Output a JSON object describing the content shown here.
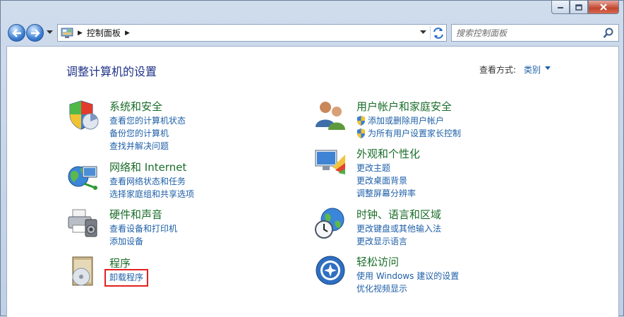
{
  "address": {
    "crumb": "控制面板",
    "search_placeholder": "搜索控制面板"
  },
  "header": {
    "title": "调整计算机的设置",
    "view_by_label": "查看方式:",
    "view_by_value": "类别"
  },
  "categories": [
    {
      "title": "系统和安全",
      "links": [
        "查看您的计算机状态",
        "备份您的计算机",
        "查找并解决问题"
      ]
    },
    {
      "title": "网络和 Internet",
      "links": [
        "查看网络状态和任务",
        "选择家庭组和共享选项"
      ]
    },
    {
      "title": "硬件和声音",
      "links": [
        "查看设备和打印机",
        "添加设备"
      ]
    },
    {
      "title": "程序",
      "links": [
        "卸载程序"
      ]
    },
    {
      "title": "用户帐户和家庭安全",
      "links": [
        "添加或删除用户帐户",
        "为所有用户设置家长控制"
      ]
    },
    {
      "title": "外观和个性化",
      "links": [
        "更改主题",
        "更改桌面背景",
        "调整屏幕分辨率"
      ]
    },
    {
      "title": "时钟、语言和区域",
      "links": [
        "更改键盘或其他输入法",
        "更改显示语言"
      ]
    },
    {
      "title": "轻松访问",
      "links": [
        "使用 Windows 建议的设置",
        "优化视频显示"
      ]
    }
  ],
  "colors": {
    "category_title": "#1a6d2a",
    "link": "#1e5fa8",
    "page_title": "#1e3287",
    "highlight": "#e22020"
  }
}
